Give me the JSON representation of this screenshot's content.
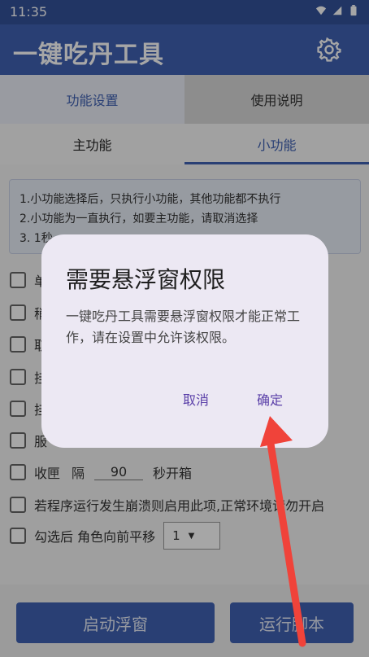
{
  "status": {
    "time": "11:35"
  },
  "app": {
    "title": "一键吃丹工具"
  },
  "tabs": {
    "feature_settings": "功能设置",
    "usage_guide": "使用说明"
  },
  "subtabs": {
    "main": "主功能",
    "mini": "小功能"
  },
  "info": {
    "line1": "1.小功能选择后，只执行小功能，其他功能都不执行",
    "line2": "2.小功能为一直执行，如要主功能，请取消选择",
    "line3": "3. 1秒..."
  },
  "options": {
    "o1": "单",
    "o2": "稍",
    "o3": "取",
    "o4": "挂",
    "o5": "挂",
    "o6": "服",
    "chest_label_a": "收匣",
    "chest_label_b": "隔",
    "chest_value": "90",
    "chest_label_c": "秒开箱",
    "crash_label": "若程序运行发生崩溃则启用此项,正常环境请勿开启",
    "move_label": "勾选后 角色向前平移",
    "move_value": "1"
  },
  "buttons": {
    "start_float": "启动浮窗",
    "run_script": "运行脚本"
  },
  "dialog": {
    "title": "需要悬浮窗权限",
    "message": "一键吃丹工具需要悬浮窗权限才能正常工作，请在设置中允许该权限。",
    "cancel": "取消",
    "confirm": "确定"
  },
  "colors": {
    "primary": "#3f61b3",
    "dialog_bg": "#ece8f3",
    "accent_text": "#5a3fa8",
    "arrow": "#f0433a"
  }
}
